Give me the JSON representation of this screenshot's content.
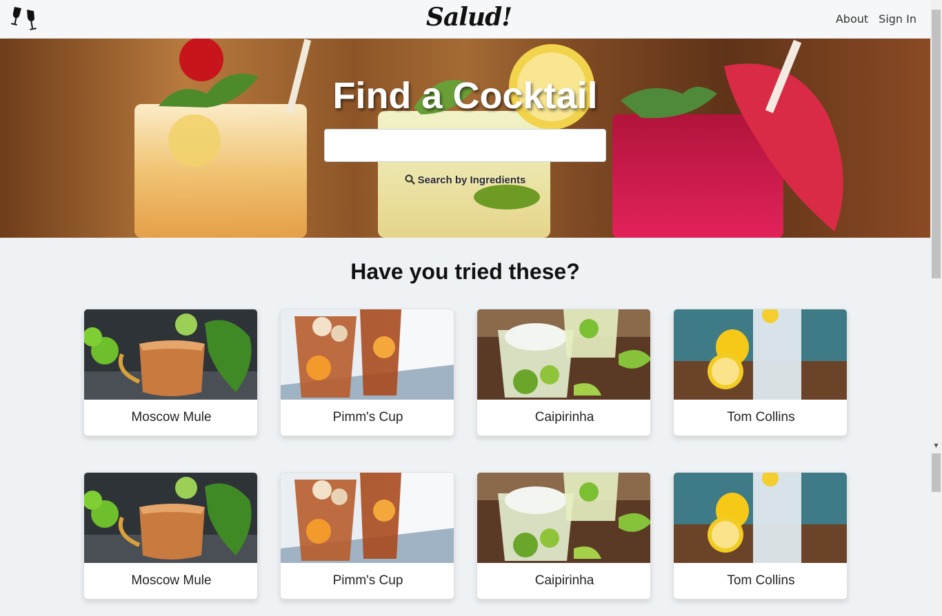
{
  "navbar": {
    "brand": "Salud!",
    "links": {
      "about": "About",
      "sign_in": "Sign In"
    }
  },
  "hero": {
    "title": "Find a Cocktail",
    "search_placeholder": "",
    "ingredients_link": "Search by Ingredients"
  },
  "section": {
    "title": "Have you tried these?"
  },
  "cards": [
    {
      "name": "Moscow Mule"
    },
    {
      "name": "Pimm's Cup"
    },
    {
      "name": "Caipirinha"
    },
    {
      "name": "Tom Collins"
    },
    {
      "name": "Moscow Mule"
    },
    {
      "name": "Pimm's Cup"
    },
    {
      "name": "Caipirinha"
    },
    {
      "name": "Tom Collins"
    }
  ],
  "colors": {
    "background": "#eff2f4",
    "navbar": "#f6f7f8",
    "card": "#ffffff"
  },
  "icons": {
    "logo": "wine-glasses-icon",
    "search": "search-icon"
  }
}
